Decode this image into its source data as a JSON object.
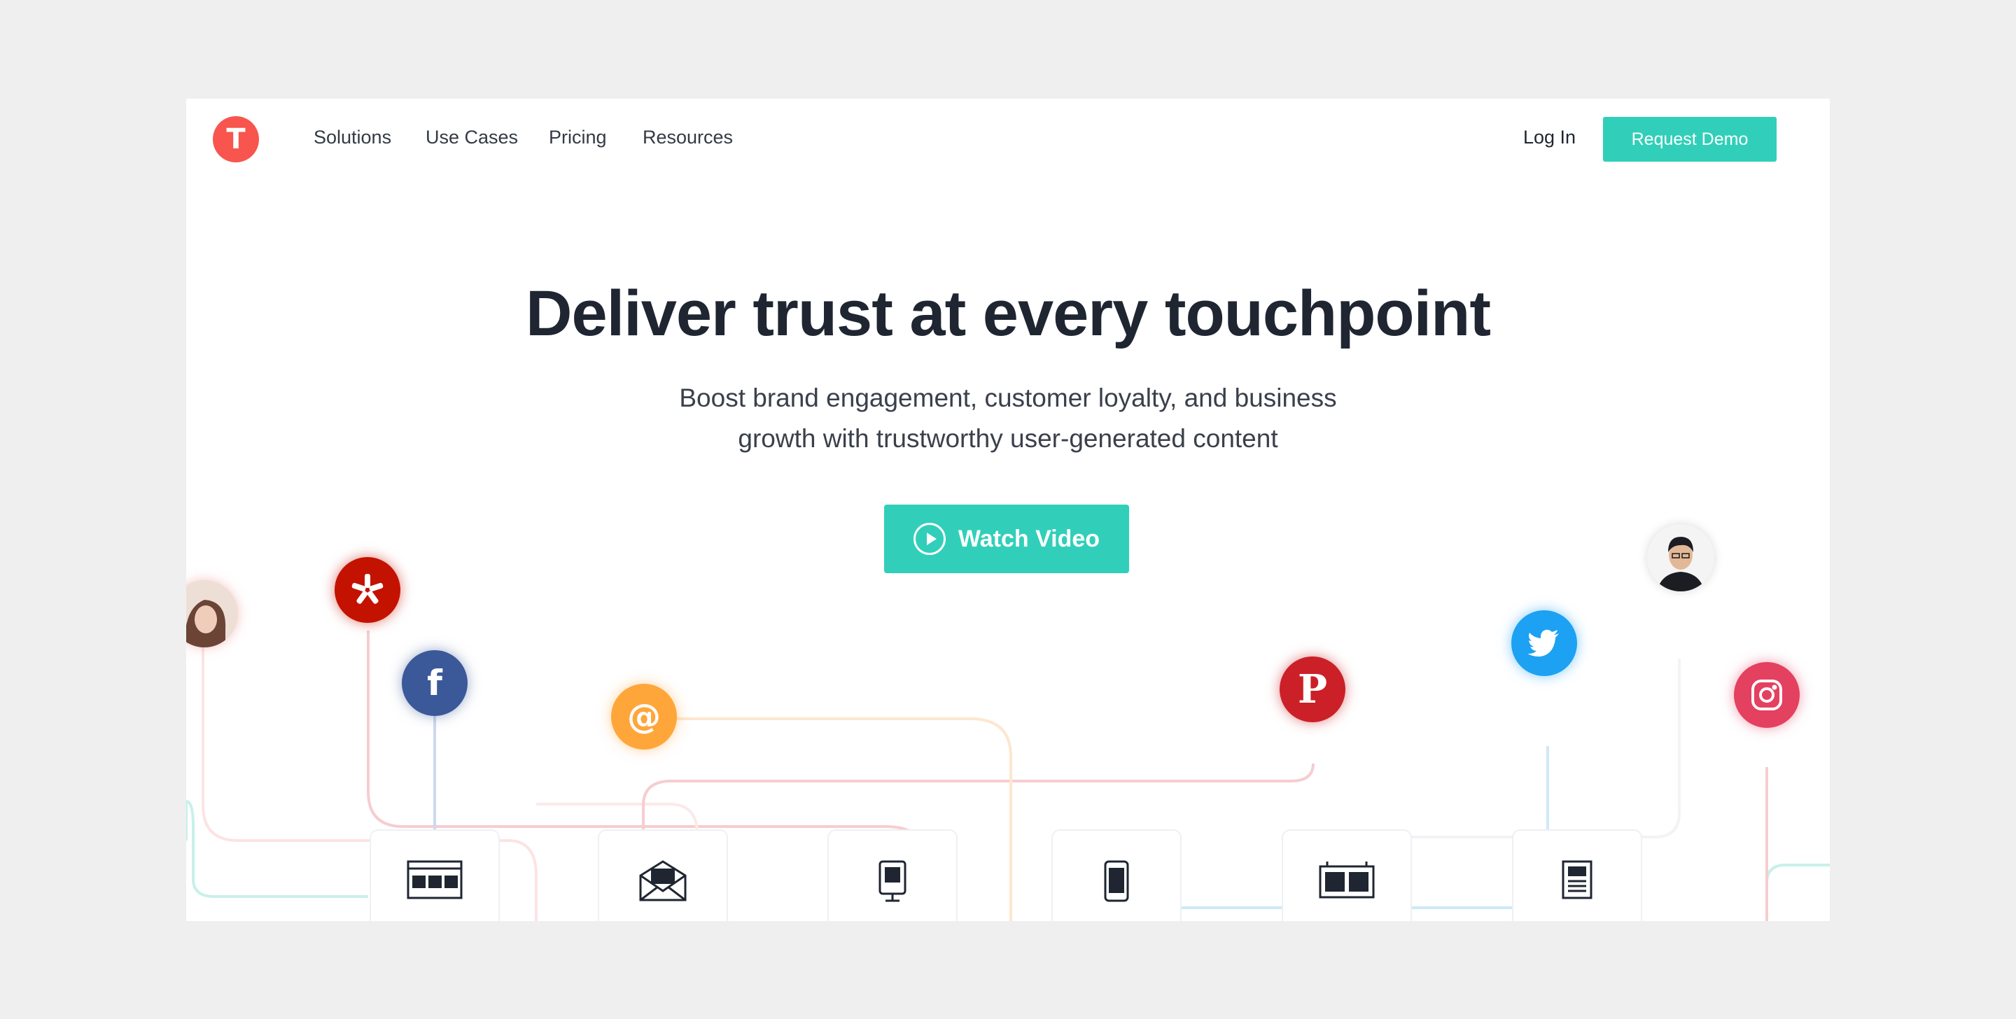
{
  "nav": {
    "logo_letter": "T",
    "links": [
      "Solutions",
      "Use Cases",
      "Pricing",
      "Resources"
    ],
    "login": "Log In",
    "demo": "Request Demo"
  },
  "hero": {
    "title": "Deliver trust at every touchpoint",
    "subtitle_line1": "Boost brand engagement, customer loyalty, and business",
    "subtitle_line2": "growth with trustworthy user-generated content",
    "cta": "Watch Video"
  },
  "icons": {
    "yelp": "yelp-icon",
    "facebook": "facebook-icon",
    "email": "at-sign-icon",
    "pinterest": "pinterest-icon",
    "twitter": "twitter-icon",
    "instagram": "instagram-icon",
    "tiles": [
      "website-banner-icon",
      "email-envelope-icon",
      "kiosk-display-icon",
      "mobile-phone-icon",
      "billboard-icon",
      "print-document-icon"
    ]
  },
  "colors": {
    "accent": "#31cfb9",
    "logo": "#f7554d",
    "text": "#1f2631",
    "yelp": "#c41200",
    "facebook": "#3b5998",
    "email": "#ffa63a",
    "pinterest": "#cb2027",
    "twitter": "#1da1f2",
    "instagram": "#e4405f"
  }
}
